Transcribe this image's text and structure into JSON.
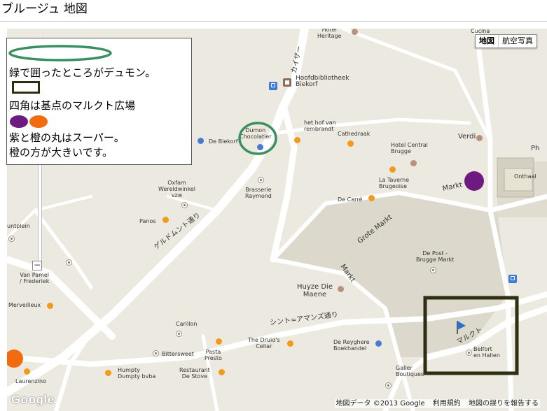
{
  "page": {
    "title": "ブルージュ 地図"
  },
  "map_controls": {
    "map_type": [
      "地図",
      "航空写真"
    ],
    "selected": "地図",
    "zoom_out": "−"
  },
  "legend": {
    "line1": "緑で囲ったところがデュモン。",
    "line2": "四角は基点のマルクト広場",
    "line3": "紫と橙の丸はスーパー。",
    "line4": "橙の方が大きいです。"
  },
  "streets": {
    "geldmuntstraat": "ゲルドムント通り",
    "sint_amandsstraat": "シント=アマンズ通り",
    "markt_jp": "マルクト",
    "kaiser": "カイザー",
    "markt": "Markt",
    "markt_vertical": "Markt",
    "grote_markt": "Grote Markt",
    "ph": "Ph",
    "onthaal": "Onthaal"
  },
  "places": {
    "hotel_heritage": "Hotel\nHeritage",
    "cucina": "Cucina",
    "hoofdbib": "Hoofdbibliotheek\nBiekorf",
    "dumon": "Dumon\nChocolatier",
    "de_biekorf": "De Biekorf",
    "het_hof": "het hof van\nrembrandt",
    "cathedraak": "Cathedraak",
    "hotel_central": "Hotel Central\nBrugge",
    "verdi": "Verdi",
    "la_taverne": "La Taverne\nBrugeoise",
    "de_carre": "De Carré",
    "oxfam": "Oxfam\nWereldwinkel\nvzw",
    "brasserie": "Brasserie\nRaymond",
    "panos": "Panos",
    "untplein": "untplein",
    "van_pamel": "Van Pamel\n/ Frederiek",
    "de_post": "De Post -\nBrugge Markt",
    "huyze": "Huyze Die\nMaene",
    "merveilleux": "Merveilleux",
    "carillon": "Carillon",
    "bittersweet": "Bittersweet",
    "pasta_presto": "Pasta\nPresto",
    "druids": "The Druid's\nCellar",
    "de_reyghere": "De Reyghere\nBoekhandel",
    "humpty": "Humpty\nDumpty bvba",
    "restaurant_stove": "Restaurant\nDe Stove",
    "laurenzino": "Laurenzino",
    "gallery": "Galler\nBoutiques",
    "belfort": "Belfort\nen Hallen"
  },
  "footer": {
    "data": "地図データ ©2013 Google",
    "terms": "利用規約",
    "report": "地図の誤りを報告する"
  },
  "logo": "Google",
  "colors": {
    "green_circle": "#3a8f60",
    "square": "#2e2e12",
    "purple": "#6f1a80",
    "orange": "#f26b0f",
    "road": "#ffffff",
    "land": "#eceae0",
    "plaza": "#dcd8cc"
  }
}
